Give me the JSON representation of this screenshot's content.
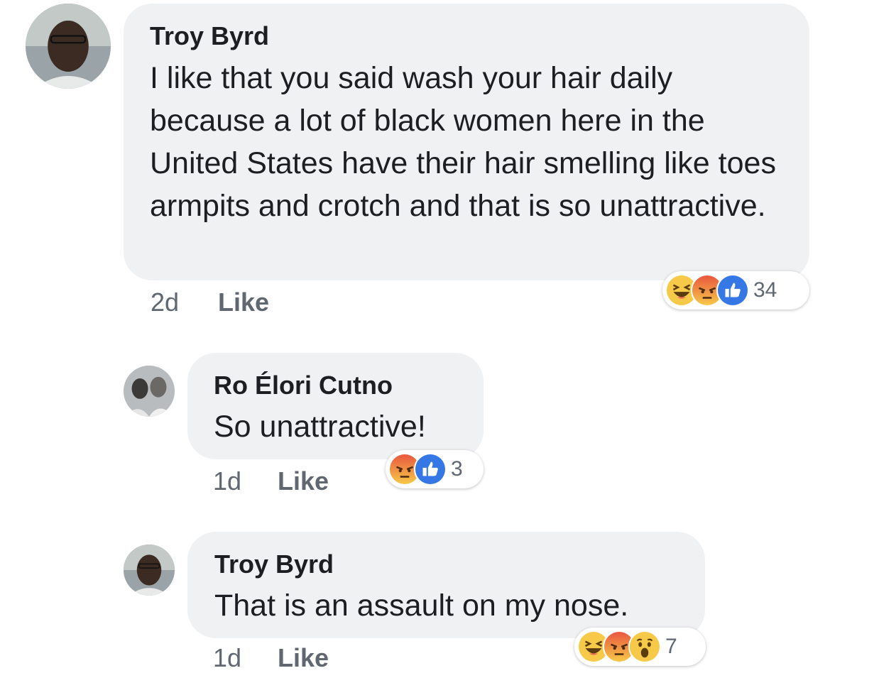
{
  "comments": [
    {
      "author": "Troy Byrd",
      "text": "I like that you said wash your hair daily because a lot of black women here in the United States have their hair smelling like toes armpits and crotch and that is so unattractive.",
      "time": "2d",
      "like_label": "Like",
      "reactions": [
        "haha-icon",
        "angry-icon",
        "like-icon"
      ],
      "reaction_count": "34"
    },
    {
      "author": "Ro Élori Cutno",
      "text": "So unattractive!",
      "time": "1d",
      "like_label": "Like",
      "reactions": [
        "angry-icon",
        "like-icon"
      ],
      "reaction_count": "3"
    },
    {
      "author": "Troy Byrd",
      "text": "That is an assault on my nose.",
      "time": "1d",
      "like_label": "Like",
      "reactions": [
        "haha-icon",
        "angry-icon",
        "wow-icon"
      ],
      "reaction_count": "7"
    }
  ],
  "colors": {
    "bubble": "#f0f1f3",
    "text": "#1c1e21",
    "meta": "#606770",
    "like_blue": "#3578e5",
    "angry_red": "#e9573f",
    "emoji_yellow": "#f7c948"
  }
}
